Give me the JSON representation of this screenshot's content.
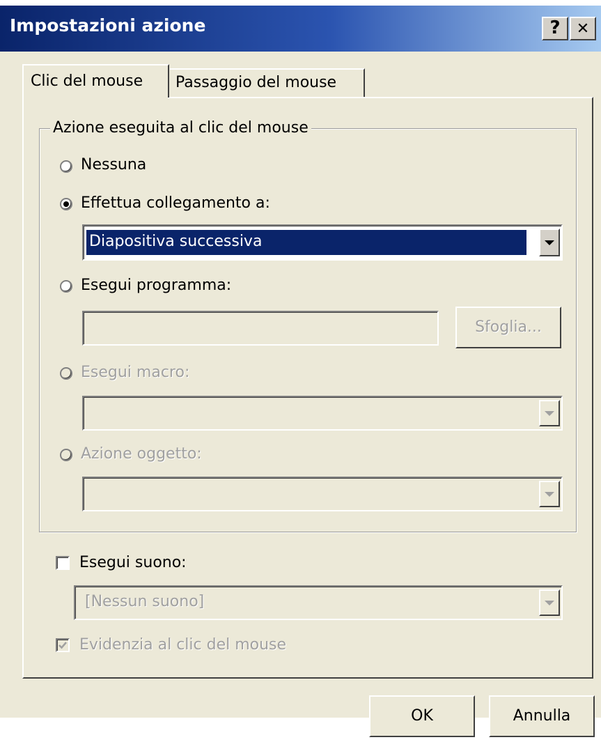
{
  "window": {
    "title": "Impostazioni azione",
    "help_glyph": "?",
    "close_glyph": "✕"
  },
  "tabs": [
    {
      "label": "Clic del mouse",
      "selected": true
    },
    {
      "label": "Passaggio del mouse",
      "selected": false
    }
  ],
  "group": {
    "legend": "Azione eseguita al clic del mouse",
    "options": {
      "none": {
        "label": "Nessuna",
        "selected": false,
        "enabled": true
      },
      "link": {
        "label": "Effettua collegamento a:",
        "selected": true,
        "enabled": true,
        "value": "Diapositiva successiva"
      },
      "program": {
        "label": "Esegui programma:",
        "selected": false,
        "enabled": true,
        "value": "",
        "browse_label": "Sfoglia..."
      },
      "macro": {
        "label": "Esegui macro:",
        "selected": false,
        "enabled": false,
        "value": ""
      },
      "object": {
        "label": "Azione oggetto:",
        "selected": false,
        "enabled": false,
        "value": ""
      }
    }
  },
  "sound": {
    "label": "Esegui suono:",
    "checked": false,
    "value": "[Nessun suono]"
  },
  "highlight": {
    "label": "Evidenzia al clic del mouse",
    "checked": true,
    "enabled": false
  },
  "buttons": {
    "ok": "OK",
    "cancel": "Annulla"
  },
  "icons": {
    "help": "help-icon",
    "close": "close-icon",
    "dropdown": "chevron-down-icon"
  },
  "colors": {
    "title_start": "#0a246a",
    "title_end": "#a6caf0",
    "dialog_face": "#ece9d8",
    "selection": "#0a246a"
  }
}
